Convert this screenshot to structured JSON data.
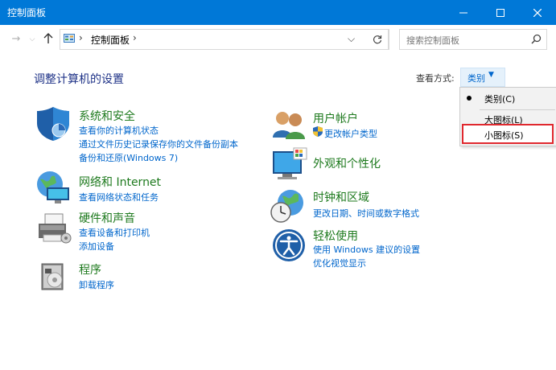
{
  "window": {
    "title": "控制面板"
  },
  "address": {
    "crumb": "控制面板",
    "sep1": "›",
    "sep2": "›"
  },
  "search": {
    "placeholder": "搜索控制面板"
  },
  "page": {
    "heading": "调整计算机的设置"
  },
  "view": {
    "label": "查看方式:",
    "current": "类别",
    "menu": [
      {
        "label": "类别(C)",
        "selected": true
      },
      {
        "label": "大图标(L)",
        "selected": false
      },
      {
        "label": "小图标(S)",
        "selected": false
      }
    ]
  },
  "categories": {
    "security": {
      "title": "系统和安全",
      "links": [
        "查看你的计算机状态",
        "通过文件历史记录保存你的文件备份副本",
        "备份和还原(Windows 7)"
      ]
    },
    "network": {
      "title": "网络和 Internet",
      "links": [
        "查看网络状态和任务"
      ]
    },
    "hardware": {
      "title": "硬件和声音",
      "links": [
        "查看设备和打印机",
        "添加设备"
      ]
    },
    "programs": {
      "title": "程序",
      "links": [
        "卸载程序"
      ]
    },
    "users": {
      "title": "用户帐户",
      "links": [
        "更改帐户类型"
      ]
    },
    "appearance": {
      "title": "外观和个性化",
      "links": []
    },
    "clock": {
      "title": "时钟和区域",
      "links": [
        "更改日期、时间或数字格式"
      ]
    },
    "ease": {
      "title": "轻松使用",
      "links": [
        "使用 Windows 建议的设置",
        "优化视觉显示"
      ]
    }
  }
}
